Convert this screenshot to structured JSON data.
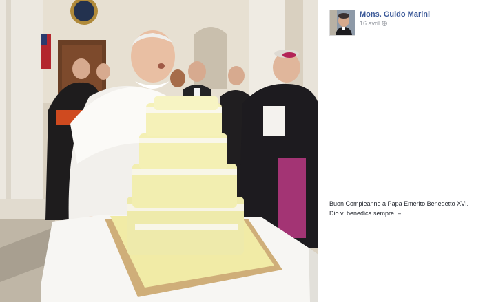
{
  "post": {
    "author": "Mons. Guido Marini",
    "date": "16 avril",
    "audience_icon": "globe-icon",
    "message_line1": "Buon Compleanno a Papa Emerito Benedetto XVI.",
    "message_line2": "Dio vi benedica sempre. –"
  },
  "colors": {
    "link": "#3b5998",
    "text": "#1d2129",
    "meta": "#90949c"
  }
}
